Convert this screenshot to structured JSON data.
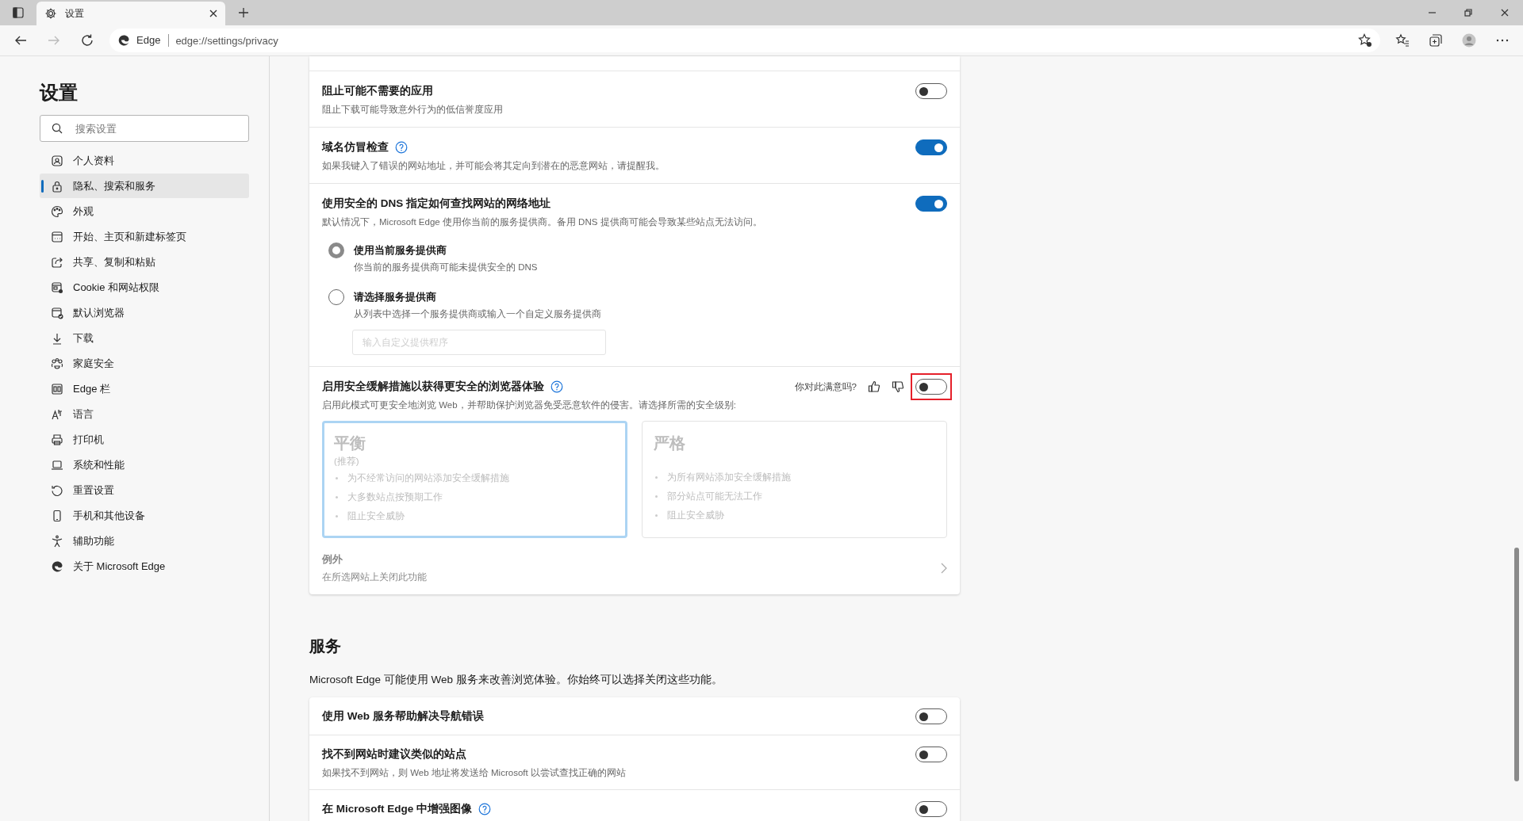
{
  "browser": {
    "tab_title": "设置",
    "site_label": "Edge",
    "url": "edge://settings/privacy"
  },
  "sidebar": {
    "title": "设置",
    "search": {
      "placeholder": "搜索设置"
    },
    "items": [
      {
        "label": "个人资料",
        "selected": false
      },
      {
        "label": "隐私、搜索和服务",
        "selected": true
      },
      {
        "label": "外观",
        "selected": false
      },
      {
        "label": "开始、主页和新建标签页",
        "selected": false
      },
      {
        "label": "共享、复制和粘贴",
        "selected": false
      },
      {
        "label": "Cookie 和网站权限",
        "selected": false
      },
      {
        "label": "默认浏览器",
        "selected": false
      },
      {
        "label": "下载",
        "selected": false
      },
      {
        "label": "家庭安全",
        "selected": false
      },
      {
        "label": "Edge 栏",
        "selected": false
      },
      {
        "label": "语言",
        "selected": false
      },
      {
        "label": "打印机",
        "selected": false
      },
      {
        "label": "系统和性能",
        "selected": false
      },
      {
        "label": "重置设置",
        "selected": false
      },
      {
        "label": "手机和其他设备",
        "selected": false
      },
      {
        "label": "辅助功能",
        "selected": false
      },
      {
        "label": "关于 Microsoft Edge",
        "selected": false
      }
    ]
  },
  "security": {
    "rows": [
      {
        "kind": "toggle",
        "title": "阻止可能不需要的应用",
        "help": false,
        "description": "阻止下载可能导致意外行为的低信誉度应用",
        "on": false
      },
      {
        "kind": "toggle",
        "title": "域名仿冒检查",
        "help": true,
        "description": "如果我键入了错误的网站地址，并可能会将其定向到潜在的恶意网站，请提醒我。",
        "on": true
      },
      {
        "kind": "dns",
        "title": "使用安全的 DNS 指定如何查找网站的网络地址",
        "help": false,
        "description": "默认情况下，Microsoft Edge 使用你当前的服务提供商。备用 DNS 提供商可能会导致某些站点无法访问。",
        "on": true,
        "options": [
          {
            "label": "使用当前服务提供商",
            "description": "你当前的服务提供商可能未提供安全的 DNS",
            "selected": true
          },
          {
            "label": "请选择服务提供商",
            "description": "从列表中选择一个服务提供商或输入一个自定义服务提供商",
            "selected": false
          }
        ],
        "custom_provider": {
          "placeholder": "输入自定义提供程序"
        }
      },
      {
        "kind": "mitigation",
        "title": "启用安全缓解措施以获得更安全的浏览器体验",
        "help": true,
        "feedback": "你对此满意吗?",
        "on": false,
        "highlighted": true,
        "description": "启用此模式可更安全地浏览 Web，并帮助保护浏览器免受恶意软件的侵害。请选择所需的安全级别:",
        "levels": [
          {
            "title": "平衡",
            "note": "(推荐)",
            "points": [
              "为不经常访问的网站添加安全缓解措施",
              "大多数站点按预期工作",
              "阻止安全威胁"
            ],
            "selected": true,
            "disabled": true
          },
          {
            "title": "严格",
            "points": [
              "为所有网站添加安全缓解措施",
              "部分站点可能无法工作",
              "阻止安全威胁"
            ],
            "selected": false,
            "disabled": true
          }
        ],
        "exceptions": {
          "title": "例外",
          "description": "在所选网站上关闭此功能",
          "disabled": true
        }
      }
    ]
  },
  "services": {
    "title": "服务",
    "description": "Microsoft Edge 可能使用 Web 服务来改善浏览体验。你始终可以选择关闭这些功能。",
    "rows": [
      {
        "title": "使用 Web 服务帮助解决导航错误",
        "help": false,
        "on": false
      },
      {
        "title": "找不到网站时建议类似的站点",
        "help": false,
        "description": "如果找不到网站，则 Web 地址将发送给 Microsoft 以尝试查找正确的网站",
        "on": false
      },
      {
        "title": "在 Microsoft Edge 中增强图像",
        "help": true,
        "on": false
      }
    ]
  }
}
